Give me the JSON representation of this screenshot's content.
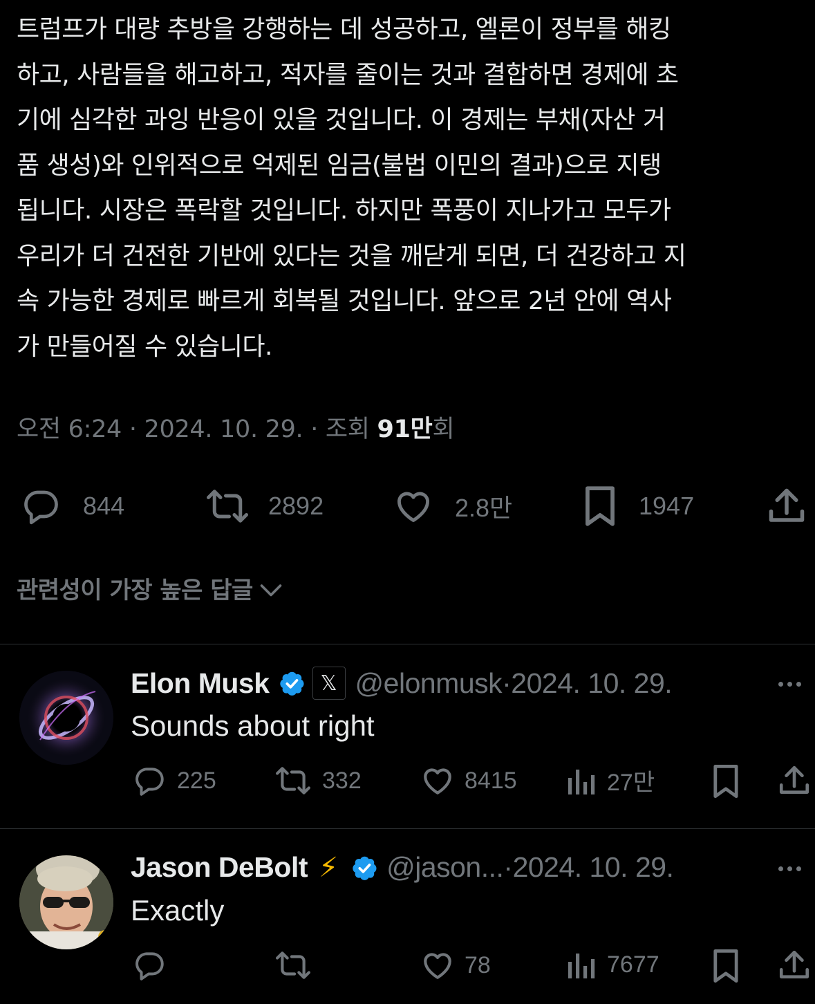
{
  "tweet": {
    "text": "트럼프가 대량 추방을 강행하는 데 성공하고, 엘론이 정부를 해킹\n하고, 사람들을 해고하고, 적자를 줄이는 것과 결합하면 경제에 초\n기에 심각한 과잉 반응이 있을 것입니다. 이 경제는 부채(자산 거\n품 생성)와 인위적으로 억제된 임금(불법 이민의 결과)으로 지탱\n됩니다. 시장은 폭락할 것입니다. 하지만 폭풍이 지나가고 모두가\n우리가 더 건전한 기반에 있다는 것을 깨닫게 되면, 더 건강하고 지\n속 가능한 경제로 빠르게 회복될 것입니다. 앞으로 2년 안에 역사\n가 만들어질 수 있습니다.",
    "time": "오전 6:24",
    "sep": " · ",
    "date": "2024. 10. 29.",
    "views_prefix": "조회 ",
    "views_value": "91만",
    "views_suffix": "회",
    "replies": "844",
    "retweets": "2892",
    "likes": "2.8만",
    "bookmarks": "1947"
  },
  "sort_label": "관련성이 가장 높은 답글",
  "replies": [
    {
      "name": "Elon Musk",
      "affiliate_badge": "𝕏",
      "handle": "@elonmusk",
      "sep": " · ",
      "date": "2024. 10. 29.",
      "text": "Sounds about right",
      "replies": "225",
      "retweets": "332",
      "likes": "8415",
      "views": "27만"
    },
    {
      "name": "Jason DeBolt",
      "emoji": "⚡",
      "handle": "@jason...",
      "sep": " · ",
      "date": "2024. 10. 29.",
      "text": "Exactly",
      "replies": "",
      "retweets": "",
      "likes": "78",
      "views": "7677"
    }
  ],
  "colors": {
    "background": "#000000",
    "text": "#e7e9ea",
    "muted": "#71767b",
    "verified": "#1d9bf0",
    "divider": "#2f3336"
  }
}
